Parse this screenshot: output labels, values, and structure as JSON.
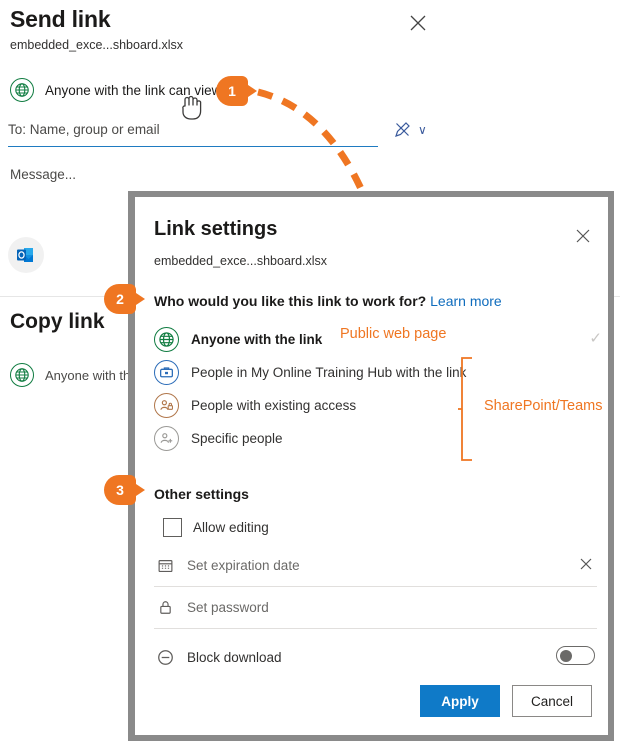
{
  "send_panel": {
    "title": "Send link",
    "file_name": "embedded_exce...shboard.xlsx",
    "close_label": "✕",
    "scope_label": "Anyone with the link can view",
    "scope_chevron": "›",
    "to_placeholder": "To: Name, group or email",
    "message_placeholder": "Message...",
    "pen_icon": "pen-icon",
    "pen_chevron": "∨",
    "outlook_icon": "outlook-icon",
    "copy_title": "Copy link",
    "copy_scope_label": "Anyone with the link can view"
  },
  "link_settings": {
    "title": "Link settings",
    "file_name": "embedded_exce...shboard.xlsx",
    "close_label": "✕",
    "question": "Who would you like this link to work for?",
    "learn_more": "Learn more",
    "audience_options": [
      {
        "label": "Anyone with the link",
        "icon": "globe-icon",
        "selected": true,
        "check": "✓"
      },
      {
        "label": "People in My Online Training Hub with the link",
        "icon": "briefcase-icon",
        "selected": false
      },
      {
        "label": "People with existing access",
        "icon": "people-lock-icon",
        "selected": false
      },
      {
        "label": "Specific people",
        "icon": "people-add-icon",
        "selected": false
      }
    ],
    "other_settings_title": "Other settings",
    "allow_editing_label": "Allow editing",
    "allow_editing_checked": false,
    "expiration_placeholder": "Set expiration date",
    "expiration_icon": "calendar-icon",
    "expiration_clear": "✕",
    "password_placeholder": "Set password",
    "password_icon": "lock-icon",
    "block_download_label": "Block download",
    "block_download_icon": "block-icon",
    "block_download_on": false,
    "apply_label": "Apply",
    "cancel_label": "Cancel"
  },
  "annotations": {
    "callouts": [
      {
        "number": "1"
      },
      {
        "number": "2"
      },
      {
        "number": "3"
      }
    ],
    "public_web_page": "Public web page",
    "sharepoint_teams": "SharePoint/Teams"
  },
  "colors": {
    "accent_orange": "#ef7622",
    "primary_blue": "#0f7ac8",
    "link_blue": "#0f6cbd",
    "globe_green": "#107c41"
  }
}
